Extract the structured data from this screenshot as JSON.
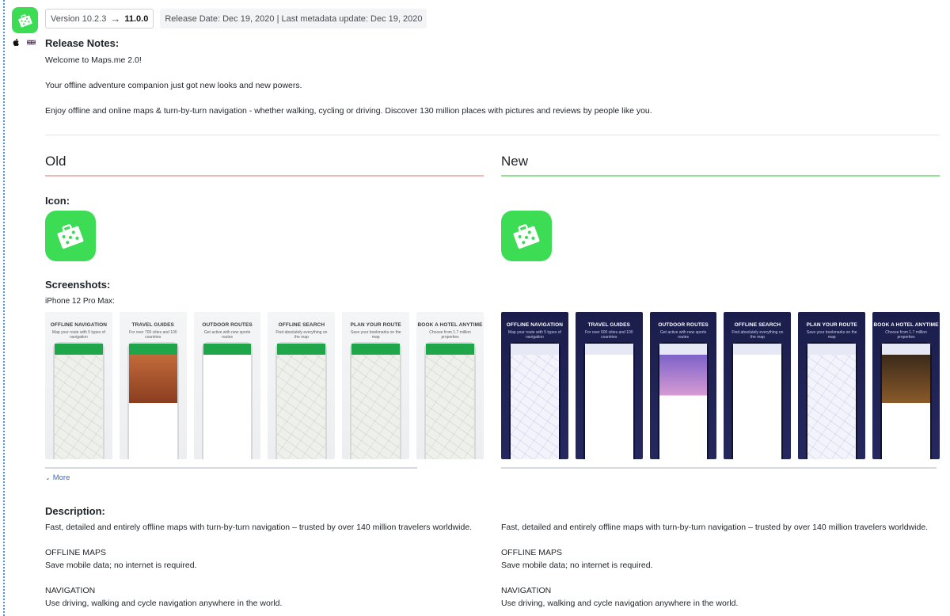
{
  "header": {
    "version_label": "Version 10.2.3",
    "arrow": "→",
    "version_new": "11.0.0",
    "release_info": "Release Date: Dec 19, 2020 | Last metadata update: Dec 19, 2020",
    "platform_icons": [
      "apple-icon",
      "uk-flag-icon"
    ]
  },
  "release_notes": {
    "title": "Release Notes:",
    "lines": [
      "Welcome to Maps.me 2.0!",
      "Your offline adventure companion just got new looks and new powers.",
      "Enjoy offline and online maps & turn-by-turn navigation - whether walking, cycling or driving. Discover 130 million places with pictures and reviews by people like you."
    ]
  },
  "columns": {
    "old_label": "Old",
    "new_label": "New",
    "old_color": "#f3b6b6",
    "new_color": "#8fe08f"
  },
  "icon_section": {
    "title": "Icon:"
  },
  "screenshots_section": {
    "title": "Screenshots:",
    "device": "iPhone 12 Pro Max:",
    "old": [
      {
        "title": "OFFLINE NAVIGATION",
        "sub": "Map your route with 5 types of navigation"
      },
      {
        "title": "TRAVEL GUIDES",
        "sub": "For over 700 cities and 100 countries"
      },
      {
        "title": "OUTDOOR ROUTES",
        "sub": "Get active with new sports routes"
      },
      {
        "title": "OFFLINE SEARCH",
        "sub": "Find absolutely everything on the map"
      },
      {
        "title": "PLAN YOUR ROUTE",
        "sub": "Save your bookmarks on the map"
      },
      {
        "title": "BOOK A HOTEL ANYTIME",
        "sub": "Choose from 1.7 million properties"
      }
    ],
    "new": [
      {
        "title": "OFFLINE NAVIGATION",
        "sub": "Map your route with 5 types of navigation"
      },
      {
        "title": "TRAVEL GUIDES",
        "sub": "For over 600 cities and 100 countries"
      },
      {
        "title": "OUTDOOR ROUTES",
        "sub": "Get active with new sports routes"
      },
      {
        "title": "OFFLINE SEARCH",
        "sub": "Find absolutely everything on the map"
      },
      {
        "title": "PLAN YOUR ROUTE",
        "sub": "Save your bookmarks on the map"
      },
      {
        "title": "BOOK A HOTEL ANYTIME",
        "sub": "Choose from 1.7 million properties"
      }
    ],
    "more_label": "More"
  },
  "description": {
    "title": "Description:",
    "old": [
      "Fast, detailed and entirely offline maps with turn-by-turn navigation – trusted by over 140 million travelers worldwide.",
      "OFFLINE MAPS",
      "Save mobile data; no internet is required.",
      "NAVIGATION",
      "Use driving, walking and cycle navigation anywhere in the world."
    ],
    "new": [
      "Fast, detailed and entirely offline maps with turn-by-turn navigation – trusted by over 140 million travelers worldwide.",
      "OFFLINE MAPS",
      "Save mobile data; no internet is required.",
      "NAVIGATION",
      "Use driving, walking and cycle navigation anywhere in the world."
    ]
  },
  "colors": {
    "app_icon": "#3ddc55",
    "link": "#2f6fd6"
  }
}
